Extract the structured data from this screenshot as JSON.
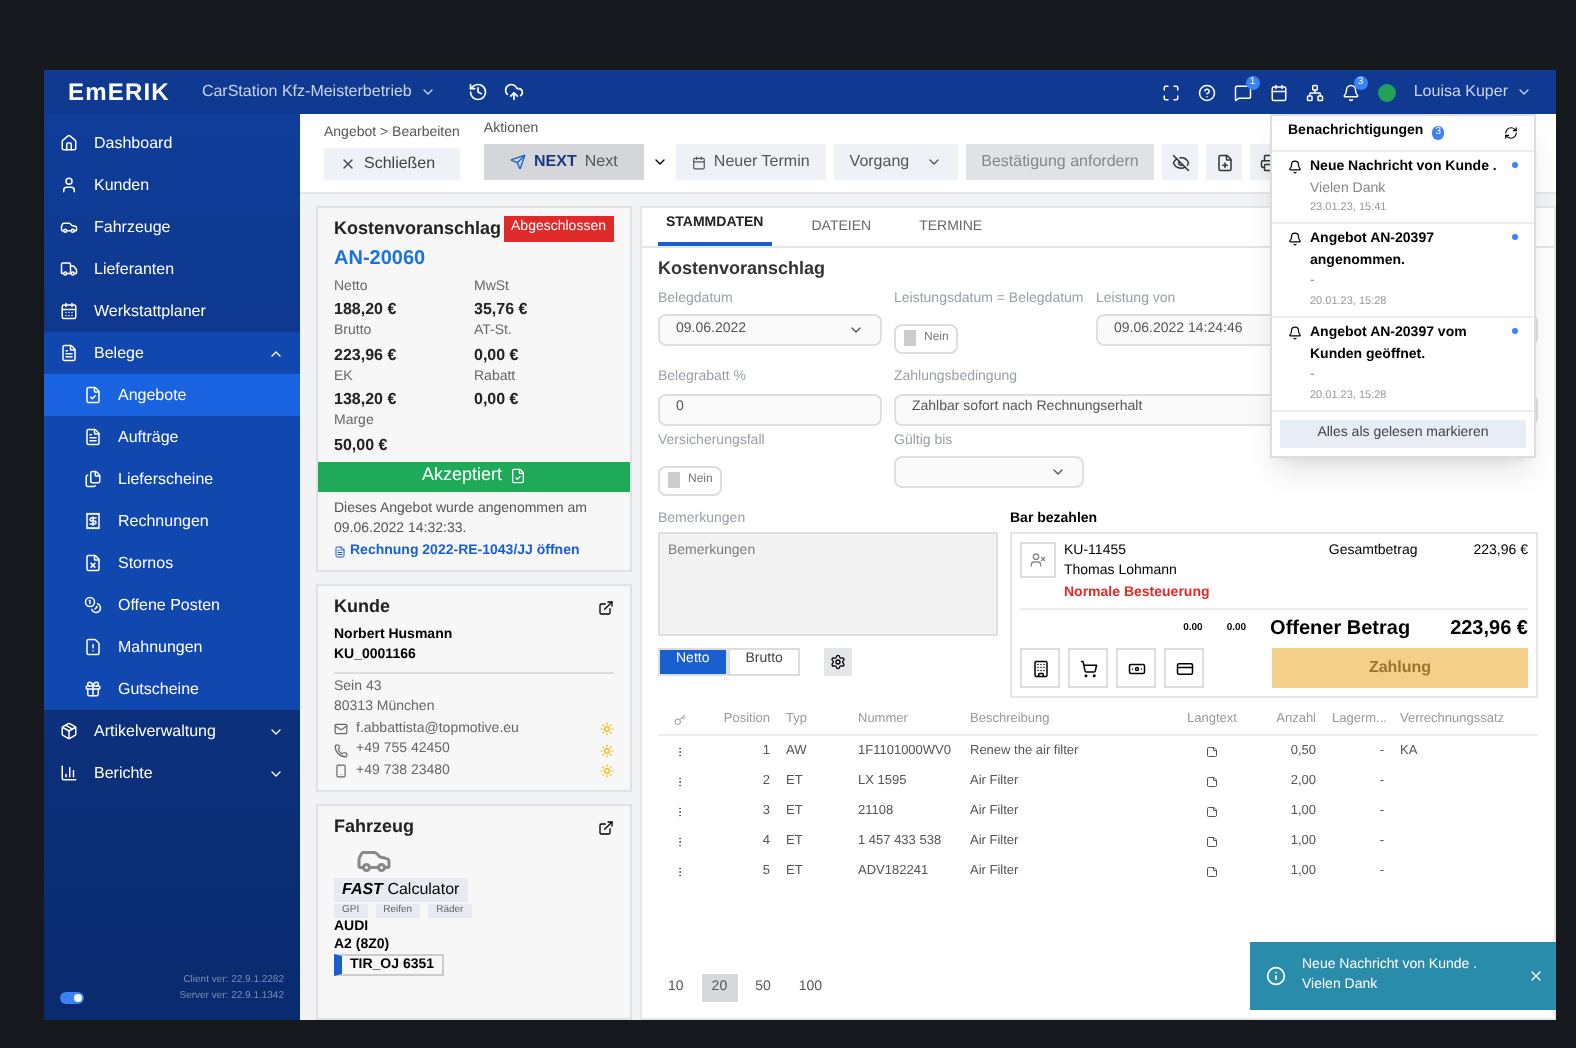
{
  "topbar": {
    "logo": "EmERIK",
    "company": "CarStation Kfz-Meisterbetrieb",
    "badges": [
      "1",
      "3"
    ],
    "user": "Louisa Kuper"
  },
  "sidebar": {
    "items": [
      {
        "label": "Dashboard",
        "selected": false
      },
      {
        "label": "Kunden",
        "selected": false
      },
      {
        "label": "Fahrzeuge",
        "selected": false
      },
      {
        "label": "Lieferanten",
        "selected": false
      },
      {
        "label": "Werkstattplaner",
        "selected": false
      },
      {
        "label": "Belege",
        "selected": false,
        "expanded": true,
        "children": [
          {
            "label": "Angebote",
            "selected": true
          },
          {
            "label": "Aufträge",
            "selected": false
          },
          {
            "label": "Lieferscheine",
            "selected": false
          },
          {
            "label": "Rechnungen",
            "selected": false
          },
          {
            "label": "Stornos",
            "selected": false
          },
          {
            "label": "Offene Posten",
            "selected": false
          },
          {
            "label": "Mahnungen",
            "selected": false
          },
          {
            "label": "Gutscheine",
            "selected": false
          }
        ]
      },
      {
        "label": "Artikelverwaltung",
        "selected": false,
        "expanded": false
      },
      {
        "label": "Berichte",
        "selected": false,
        "expanded": false
      }
    ],
    "toggle_on": true,
    "client_version": "Client ver: 22.9.1.2282",
    "server_version": "Server ver: 22.9.1.1342"
  },
  "toolbar": {
    "breadcrumb": "Angebot > Bearbeiten",
    "close": "Schließen",
    "actions_label": "Aktionen",
    "next_logo": "NEXT",
    "next": "Next",
    "new_appointment": "Neuer Termin",
    "process": "Vorgang",
    "request": "Bestätigung anfordern"
  },
  "summary": {
    "title": "Kostenvoranschlag",
    "number": "AN-20060",
    "status": "Abgeschlossen",
    "amounts": [
      {
        "label": "Netto",
        "value": "188,20 €"
      },
      {
        "label": "MwSt",
        "value": "35,76 €"
      },
      {
        "label": "Brutto",
        "value": "223,96 €"
      },
      {
        "label": "AT-St.",
        "value": "0,00 €"
      },
      {
        "label": "EK",
        "value": "138,20 €"
      },
      {
        "label": "Rabatt",
        "value": "0,00 €"
      },
      {
        "label": "Marge",
        "value": "50,00 €"
      }
    ],
    "accepted": "Akzeptiert",
    "note": "Dieses Angebot wurde angenommen am 09.06.2022 14:32:33.",
    "link": "Rechnung 2022-RE-1043/JJ öffnen"
  },
  "customer": {
    "title": "Kunde",
    "name": "Norbert Husmann",
    "number": "KU_0001166",
    "street": "Sein 43",
    "city": "80313 München",
    "contacts": [
      {
        "kind": "mail",
        "value": "f.abbattista@topmotive.eu"
      },
      {
        "kind": "phone",
        "value": "+49 755 42450"
      },
      {
        "kind": "mobile",
        "value": "+49 738 23480"
      }
    ]
  },
  "vehicle": {
    "title": "Fahrzeug",
    "calculator_brand": "FAST",
    "calculator": "Calculator",
    "tags": [
      "GPI",
      "Reifen",
      "Räder"
    ],
    "make": "AUDI",
    "model": "A2 (8Z0)",
    "plate": "TIR_OJ 6351"
  },
  "tabs": [
    {
      "label": "STAMMDATEN",
      "selected": true
    },
    {
      "label": "DATEIEN",
      "selected": false
    },
    {
      "label": "TERMINE",
      "selected": false
    }
  ],
  "form": {
    "title": "Kostenvoranschlag",
    "rows": [
      [
        {
          "kind": "select",
          "label": "Belegdatum",
          "value": "09.06.2022"
        },
        {
          "kind": "toggle",
          "label": "Leistungsdatum = Belegdatum",
          "value": "Nein",
          "on": false
        },
        {
          "kind": "text",
          "label": "Leistung von",
          "value": "09.06.2022 14:24:46"
        }
      ],
      [
        {
          "kind": "text",
          "label": "Belegrabatt %",
          "value": "0"
        },
        {
          "kind": "text",
          "label": "Zahlungsbedingung",
          "value": "Zahlbar sofort nach Rechnungserhalt"
        }
      ],
      [
        {
          "kind": "toggle",
          "label": "Versicherungsfall",
          "value": "Nein",
          "on": false
        },
        {
          "kind": "select",
          "label": "Gültig bis"
        }
      ]
    ],
    "remarks_label": "Bemerkungen",
    "remarks_placeholder": "Bemerkungen"
  },
  "payment": {
    "title": "Bar bezahlen",
    "customer_number": "KU-11455",
    "customer_name": "Thomas Lohmann",
    "taxation": "Normale Besteuerung",
    "total_label": "Gesamtbetrag",
    "total": "223,96 €",
    "value_1": "0.00",
    "value_2": "0.00",
    "open_label": "Offener Betrag",
    "open": "223,96 €",
    "pay": "Zahlung",
    "pay_disabled": true
  },
  "price_mode": [
    {
      "label": "Netto",
      "selected": true
    },
    {
      "label": "Brutto",
      "selected": false
    }
  ],
  "table": {
    "columns": [
      "Position",
      "Typ",
      "Nummer",
      "Beschreibung",
      "Langtext",
      "Anzahl",
      "Lagerm...",
      "Verrechnungssatz"
    ],
    "rows": [
      [
        "1",
        "AW",
        "1F1101000WV0",
        "Renew the air filter",
        "",
        "0,50",
        "-",
        "KA"
      ],
      [
        "2",
        "ET",
        "LX 1595",
        "Air Filter",
        "",
        "2,00",
        "-",
        ""
      ],
      [
        "3",
        "ET",
        "21108",
        "Air Filter",
        "",
        "1,00",
        "-",
        ""
      ],
      [
        "4",
        "ET",
        "1 457 433 538",
        "Air Filter",
        "",
        "1,00",
        "-",
        ""
      ],
      [
        "5",
        "ET",
        "ADV182241",
        "Air Filter",
        "",
        "1,00",
        "-",
        ""
      ]
    ]
  },
  "page_sizes": [
    {
      "label": "10",
      "selected": false
    },
    {
      "label": "20",
      "selected": true
    },
    {
      "label": "50",
      "selected": false
    },
    {
      "label": "100",
      "selected": false
    }
  ],
  "notifications": {
    "title": "Benachrichtigungen",
    "count": "3",
    "items": [
      {
        "title": "Neue Nachricht von Kunde .",
        "body": "Vielen Dank",
        "time": "23.01.23, 15:41",
        "unread": true
      },
      {
        "title": "Angebot AN-20397 angenommen.",
        "body": "-",
        "time": "20.01.23, 15:28",
        "unread": true
      },
      {
        "title": "Angebot AN-20397 vom Kunden geöffnet.",
        "body": "-",
        "time": "20.01.23, 15:28",
        "unread": true
      }
    ],
    "mark_all": "Alles als gelesen markieren"
  },
  "toast": {
    "title": "Neue Nachricht von Kunde .",
    "body": "Vielen Dank"
  }
}
